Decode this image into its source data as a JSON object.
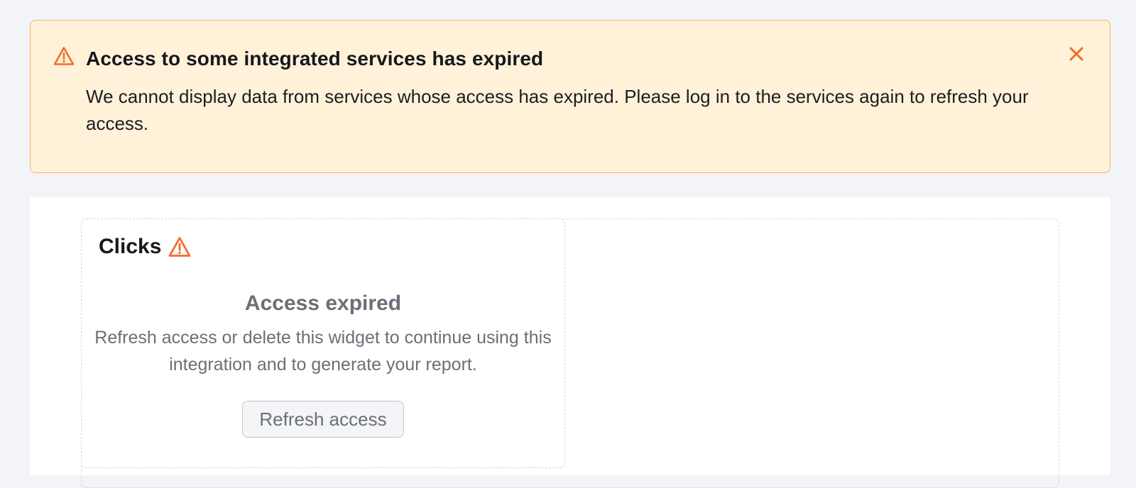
{
  "alert": {
    "icon": "warning-icon",
    "title": "Access to some integrated services has expired",
    "message": "We cannot display data from services whose access has expired. Please log in to the services again to refresh your access.",
    "close_icon": "close-icon",
    "accent_color": "#f26b2b",
    "background_color": "#fff2d9",
    "border_color": "#f5b36b"
  },
  "widget": {
    "title": "Clicks",
    "warning_icon": "warning-icon",
    "state_title": "Access expired",
    "state_message": "Refresh access or delete this widget to continue using this integration and to generate your report.",
    "refresh_button_label": "Refresh access"
  }
}
